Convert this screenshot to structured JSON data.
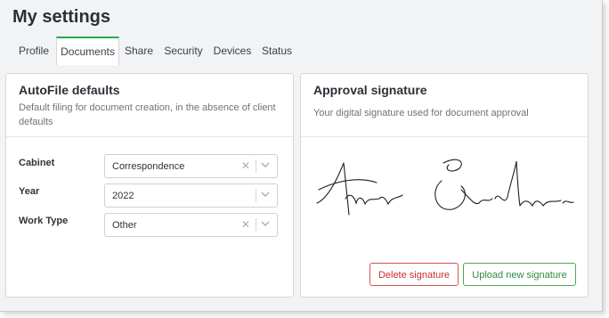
{
  "page": {
    "title": "My settings"
  },
  "tabs": [
    {
      "label": "Profile",
      "active": false
    },
    {
      "label": "Documents",
      "active": true
    },
    {
      "label": "Share",
      "active": false
    },
    {
      "label": "Security",
      "active": false
    },
    {
      "label": "Devices",
      "active": false
    },
    {
      "label": "Status",
      "active": false
    }
  ],
  "autofile": {
    "title": "AutoFile defaults",
    "subtitle": "Default filing for document creation, in the absence of client defaults",
    "fields": [
      {
        "label": "Cabinet",
        "value": "Correspondence",
        "clearable": true
      },
      {
        "label": "Year",
        "value": "2022",
        "clearable": false
      },
      {
        "label": "Work Type",
        "value": "Other",
        "clearable": true
      }
    ]
  },
  "signature": {
    "title": "Approval signature",
    "subtitle": "Your digital signature used for document approval",
    "delete_label": "Delete signature",
    "upload_label": "Upload new signature"
  },
  "colors": {
    "accent": "#2aa65a",
    "danger": "#d9534f",
    "success": "#4cae4c",
    "background": "#f2f3f5"
  },
  "icons": {
    "clear": "times-icon",
    "dropdown": "chevron-down-icon"
  }
}
